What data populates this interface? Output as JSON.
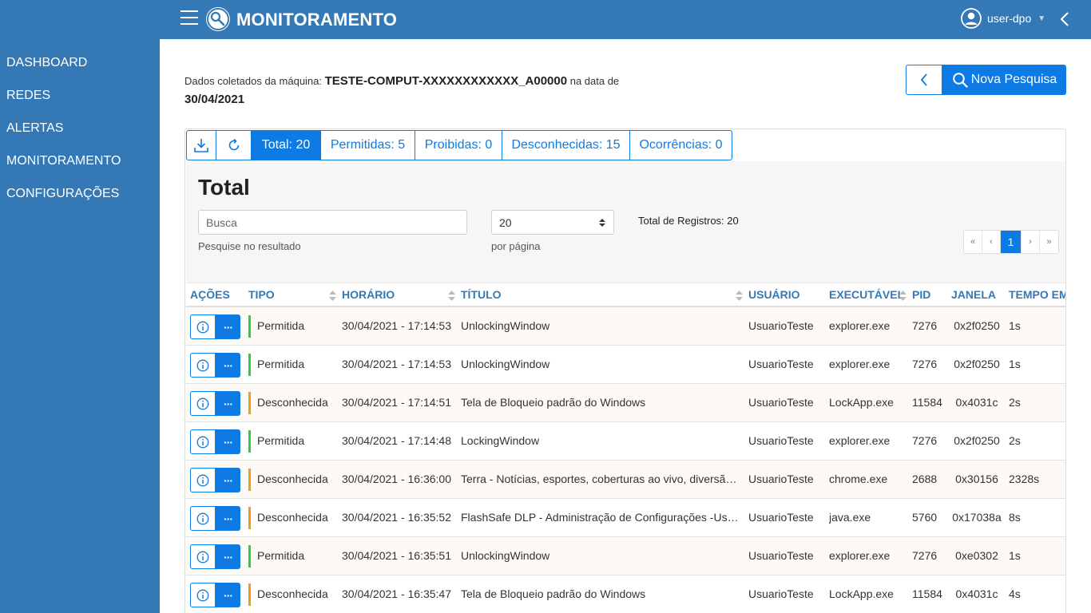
{
  "header": {
    "app_title": "MONITORAMENTO",
    "user_name": "user-dpo",
    "icons": [
      "menu-icon",
      "logo-icon",
      "user-icon",
      "caret-down-icon",
      "chevron-left-icon"
    ]
  },
  "sidebar": {
    "items": [
      {
        "label": "DASHBOARD"
      },
      {
        "label": "REDES"
      },
      {
        "label": "ALERTAS"
      },
      {
        "label": "MONITORAMENTO"
      },
      {
        "label": "CONFIGURAÇÕES"
      }
    ]
  },
  "info": {
    "prefix": "Dados coletados da máquina:",
    "machine": "TESTE-COMPUT-XXXXXXXXXXXX_A00000",
    "middle": "na data de",
    "date": "30/04/2021"
  },
  "buttons": {
    "new_search": "Nova Pesquisa"
  },
  "tabs": [
    {
      "label": "Total: 20",
      "active": true
    },
    {
      "label": "Permitidas: 5",
      "active": false
    },
    {
      "label": "Proibidas: 0",
      "active": false
    },
    {
      "label": "Desconhecidas: 15",
      "active": false
    },
    {
      "label": "Ocorrências: 0",
      "active": false
    }
  ],
  "filter": {
    "title": "Total",
    "search_placeholder": "Busca",
    "search_help": "Pesquise no resultado",
    "per_page_value": "20",
    "per_page_help": "por página",
    "total_records": "Total de Registros: 20"
  },
  "pagination": {
    "first": "«",
    "prev": "‹",
    "current": "1",
    "next": "›",
    "last": "»"
  },
  "table": {
    "headers": {
      "acoes": "AÇÕES",
      "tipo": "TIPO",
      "horario": "HORÁRIO",
      "titulo": "TÍTULO",
      "usuario": "USUÁRIO",
      "executavel": "EXECUTÁVEL",
      "pid": "PID",
      "janela": "JANELA",
      "tempo": "TEMPO EM"
    },
    "type_colors": {
      "Permitida": "#2ecc40",
      "Desconhecida": "#f39c12"
    },
    "rows": [
      {
        "tipo": "Permitida",
        "horario": "30/04/2021 - 17:14:53",
        "titulo": "UnlockingWindow",
        "usuario": "UsuarioTeste",
        "executavel": "explorer.exe",
        "pid": "7276",
        "janela": "0x2f0250",
        "tempo": "1s"
      },
      {
        "tipo": "Permitida",
        "horario": "30/04/2021 - 17:14:53",
        "titulo": "UnlockingWindow",
        "usuario": "UsuarioTeste",
        "executavel": "explorer.exe",
        "pid": "7276",
        "janela": "0x2f0250",
        "tempo": "1s"
      },
      {
        "tipo": "Desconhecida",
        "horario": "30/04/2021 - 17:14:51",
        "titulo": "Tela de Bloqueio padrão do Windows",
        "usuario": "UsuarioTeste",
        "executavel": "LockApp.exe",
        "pid": "11584",
        "janela": "0x4031c",
        "tempo": "2s"
      },
      {
        "tipo": "Permitida",
        "horario": "30/04/2021 - 17:14:48",
        "titulo": "LockingWindow",
        "usuario": "UsuarioTeste",
        "executavel": "explorer.exe",
        "pid": "7276",
        "janela": "0x2f0250",
        "tempo": "2s"
      },
      {
        "tipo": "Desconhecida",
        "horario": "30/04/2021 - 16:36:00",
        "titulo": "Terra - Notícias, esportes, coberturas ao vivo, diversão e...",
        "usuario": "UsuarioTeste",
        "executavel": "chrome.exe",
        "pid": "2688",
        "janela": "0x30156",
        "tempo": "2328s"
      },
      {
        "tipo": "Desconhecida",
        "horario": "30/04/2021 - 16:35:52",
        "titulo": "FlashSafe DLP - Administração de Configurações -Uso de...",
        "usuario": "UsuarioTeste",
        "executavel": "java.exe",
        "pid": "5760",
        "janela": "0x17038a",
        "tempo": "8s"
      },
      {
        "tipo": "Permitida",
        "horario": "30/04/2021 - 16:35:51",
        "titulo": "UnlockingWindow",
        "usuario": "UsuarioTeste",
        "executavel": "explorer.exe",
        "pid": "7276",
        "janela": "0xe0302",
        "tempo": "1s"
      },
      {
        "tipo": "Desconhecida",
        "horario": "30/04/2021 - 16:35:47",
        "titulo": "Tela de Bloqueio padrão do Windows",
        "usuario": "UsuarioTeste",
        "executavel": "LockApp.exe",
        "pid": "11584",
        "janela": "0x4031c",
        "tempo": "4s"
      }
    ]
  }
}
